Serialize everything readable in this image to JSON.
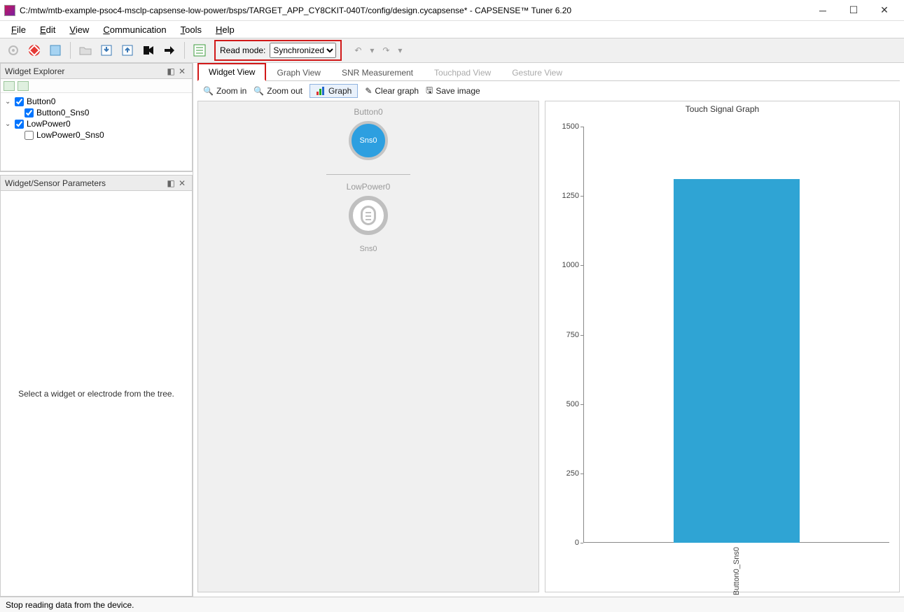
{
  "window": {
    "title": "C:/mtw/mtb-example-psoc4-msclp-capsense-low-power/bsps/TARGET_APP_CY8CKIT-040T/config/design.cycapsense* - CAPSENSE™ Tuner 6.20"
  },
  "menu": {
    "items": [
      "File",
      "Edit",
      "View",
      "Communication",
      "Tools",
      "Help"
    ]
  },
  "toolbar": {
    "read_mode_label": "Read mode:",
    "read_mode_value": "Synchronized"
  },
  "left": {
    "explorer_title": "Widget Explorer",
    "params_title": "Widget/Sensor Parameters",
    "params_placeholder": "Select a widget or electrode from the tree.",
    "tree": [
      {
        "name": "Button0",
        "checked": true,
        "children": [
          {
            "name": "Button0_Sns0",
            "checked": true
          }
        ]
      },
      {
        "name": "LowPower0",
        "checked": true,
        "children": [
          {
            "name": "LowPower0_Sns0",
            "checked": false
          }
        ]
      }
    ]
  },
  "tabs": {
    "items": [
      "Widget View",
      "Graph View",
      "SNR Measurement",
      "Touchpad View",
      "Gesture View"
    ],
    "active": 0,
    "disabled": [
      3,
      4
    ]
  },
  "subtoolbar": {
    "zoom_in": "Zoom in",
    "zoom_out": "Zoom out",
    "graph": "Graph",
    "clear": "Clear graph",
    "save": "Save image"
  },
  "widget_canvas": {
    "w0_label": "Button0",
    "w0_sensor": "Sns0",
    "w1_label": "LowPower0",
    "w1_sensor": "Sns0"
  },
  "chart_data": {
    "type": "bar",
    "title": "Touch Signal Graph",
    "ylim": [
      0,
      1500
    ],
    "yticks": [
      0,
      250,
      500,
      750,
      1000,
      1250,
      1500
    ],
    "categories": [
      "Button0_Sns0"
    ],
    "values": [
      1310
    ]
  },
  "status": {
    "text": "Stop reading data from the device."
  }
}
